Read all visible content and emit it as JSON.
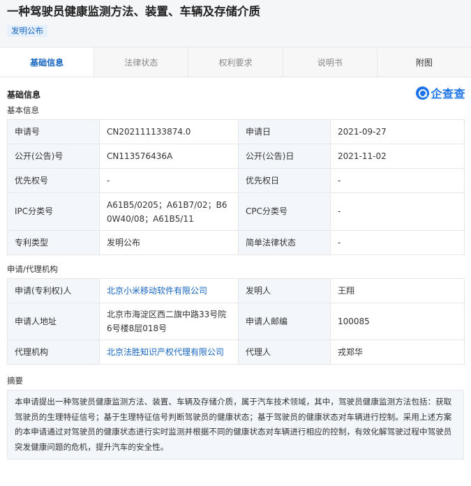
{
  "header": {
    "title": "一种驾驶员健康监测方法、装置、车辆及存储介质",
    "badge": "发明公布"
  },
  "tabs": [
    {
      "label": "基础信息",
      "active": true
    },
    {
      "label": "法律状态",
      "active": false
    },
    {
      "label": "权利要求",
      "active": false
    },
    {
      "label": "说明书",
      "active": false
    },
    {
      "label": "附图",
      "active": false
    }
  ],
  "section": {
    "title": "基础信息",
    "brand": "企查查"
  },
  "basic": {
    "subtitle": "基本信息",
    "rows": [
      [
        {
          "k": "申请号",
          "v": "CN202111133874.0"
        },
        {
          "k": "申请日",
          "v": "2021-09-27"
        }
      ],
      [
        {
          "k": "公开(公告)号",
          "v": "CN113576436A"
        },
        {
          "k": "公开(公告)日",
          "v": "2021-11-02"
        }
      ],
      [
        {
          "k": "优先权号",
          "v": "-"
        },
        {
          "k": "优先权日",
          "v": "-"
        }
      ],
      [
        {
          "k": "IPC分类号",
          "v": "A61B5/0205；A61B7/02；B60W40/08；A61B5/11"
        },
        {
          "k": "CPC分类号",
          "v": "-"
        }
      ],
      [
        {
          "k": "专利类型",
          "v": "发明公布"
        },
        {
          "k": "简单法律状态",
          "v": "-"
        }
      ]
    ]
  },
  "agency": {
    "subtitle": "申请/代理机构",
    "rows": [
      [
        {
          "k": "申请(专利权)人",
          "v": "北京小米移动软件有限公司"
        },
        {
          "k": "发明人",
          "v": "王翔"
        }
      ],
      [
        {
          "k": "申请人地址",
          "v": "北京市海淀区西二旗中路33号院6号楼8层018号"
        },
        {
          "k": "申请人邮编",
          "v": "100085"
        }
      ],
      [
        {
          "k": "代理机构",
          "v": "北京法胜知识产权代理有限公司"
        },
        {
          "k": "代理人",
          "v": "戎郑华"
        }
      ]
    ]
  },
  "abstract": {
    "subtitle": "摘要",
    "text": "本申请提出一种驾驶员健康监测方法、装置、车辆及存储介质，属于汽车技术领域，其中，驾驶员健康监测方法包括：获取驾驶员的生理特征信号；基于生理特征信号判断驾驶员的健康状态；基于驾驶员的健康状态对车辆进行控制。采用上述方案的本申请通过对驾驶员的健康状态进行实时监测并根据不同的健康状态对车辆进行相应的控制，有效化解驾驶过程中驾驶员突发健康问题的危机，提升汽车的安全性。"
  }
}
